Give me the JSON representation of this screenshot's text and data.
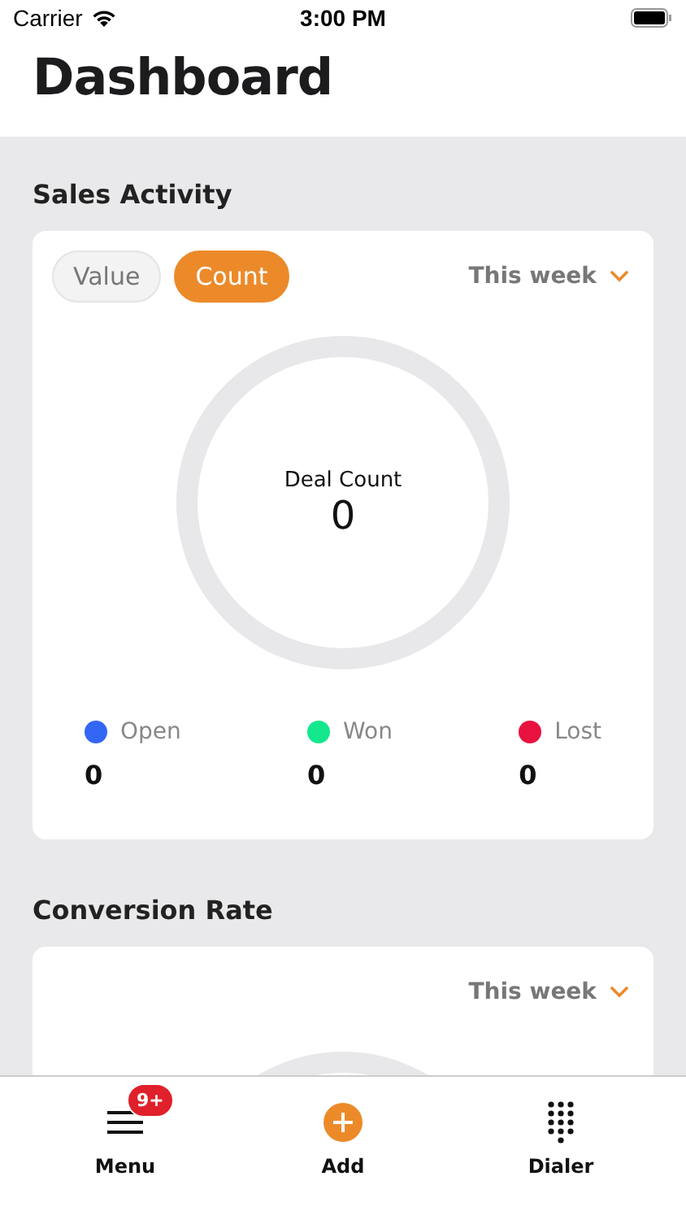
{
  "status_bar": {
    "carrier": "Carrier",
    "time": "3:00 PM"
  },
  "header": {
    "title": "Dashboard"
  },
  "sections": [
    {
      "title": "Sales Activity",
      "toggles": [
        {
          "label": "Value",
          "selected": false
        },
        {
          "label": "Count",
          "selected": true
        }
      ],
      "period": "This week",
      "center_label": "Deal Count",
      "center_value": "0",
      "legend": [
        {
          "label": "Open",
          "color": "#3366f5",
          "value": "0"
        },
        {
          "label": "Won",
          "color": "#14e88c",
          "value": "0"
        },
        {
          "label": "Lost",
          "color": "#e8123f",
          "value": "0"
        }
      ]
    },
    {
      "title": "Conversion Rate",
      "period": "This week"
    }
  ],
  "tab_bar": [
    {
      "kind": "menu",
      "label": "Menu",
      "badge": "9+"
    },
    {
      "kind": "add",
      "label": "Add"
    },
    {
      "kind": "dialer",
      "label": "Dialer"
    }
  ]
}
